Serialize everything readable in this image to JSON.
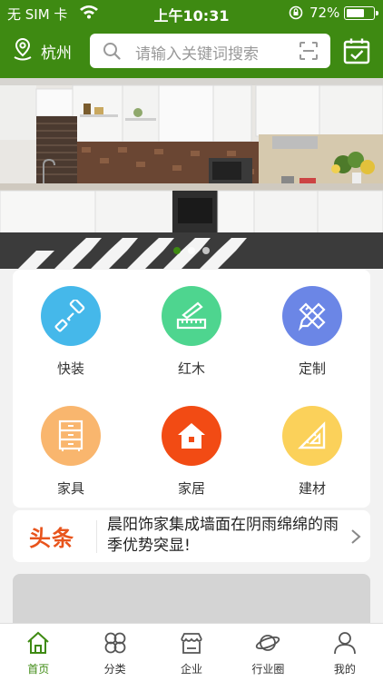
{
  "status": {
    "carrier": "无 SIM 卡",
    "time": "上午10:31",
    "battery": "72%",
    "battery_level": 0.72
  },
  "header": {
    "city": "杭州",
    "search_placeholder": "请输入关键词搜索"
  },
  "banner": {
    "slides": 3,
    "active_slide": 0
  },
  "categories": [
    {
      "label": "快装",
      "color": "#45b8ea",
      "icon": "paint-roller-icon"
    },
    {
      "label": "红木",
      "color": "#4ed58f",
      "icon": "ruler-pencil-icon"
    },
    {
      "label": "定制",
      "color": "#6b86e6",
      "icon": "pencil-ruler-icon"
    },
    {
      "label": "家具",
      "color": "#f9b66e",
      "icon": "cabinet-icon"
    },
    {
      "label": "家居",
      "color": "#f24b14",
      "icon": "home-icon"
    },
    {
      "label": "建材",
      "color": "#fbd15a",
      "icon": "triangle-ruler-icon"
    }
  ],
  "news": {
    "tag": "头条",
    "headline": "晨阳饰家集成墙面在阴雨绵绵的雨季优势突显!"
  },
  "tabs": [
    {
      "label": "首页",
      "icon": "home-tab-icon",
      "active": true
    },
    {
      "label": "分类",
      "icon": "category-tab-icon",
      "active": false
    },
    {
      "label": "企业",
      "icon": "shop-tab-icon",
      "active": false
    },
    {
      "label": "行业圈",
      "icon": "planet-tab-icon",
      "active": false
    },
    {
      "label": "我的",
      "icon": "user-tab-icon",
      "active": false
    }
  ],
  "colors": {
    "brand": "#3e8a12",
    "news_tag": "#e8541c"
  }
}
